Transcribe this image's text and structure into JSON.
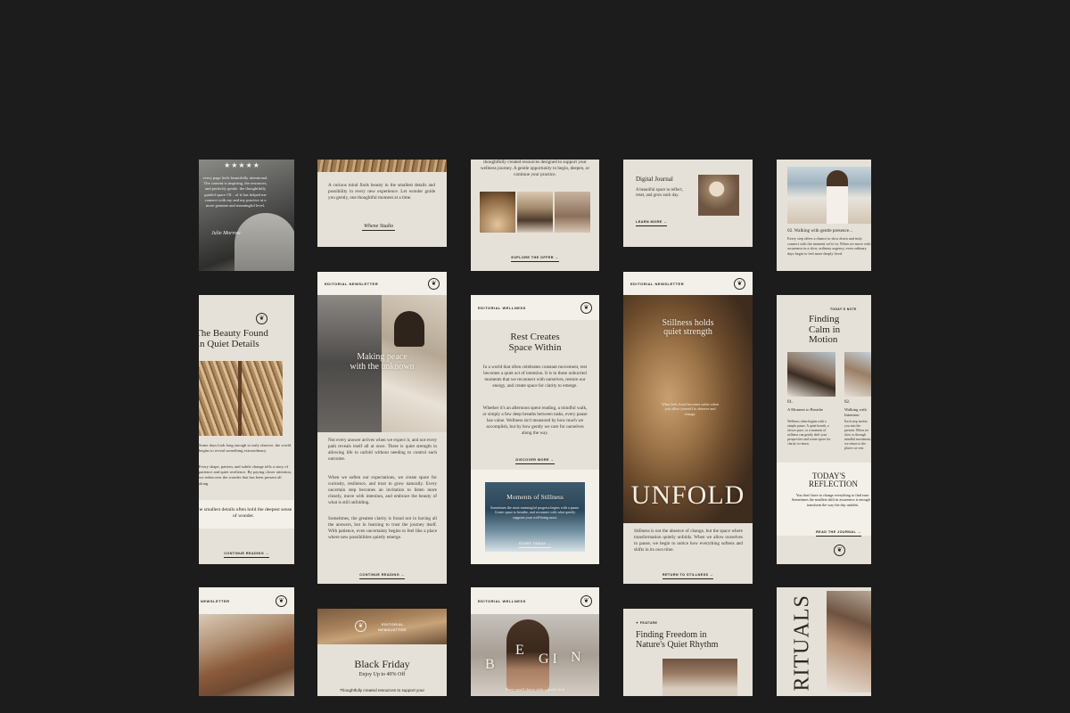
{
  "row1": {
    "c1": {
      "stars": "★★★★★",
      "text": "every page feels beautifully intentional. The content is inspiring, the resources, and perfectly gentle. the thoughtfully guided space I'll... of it has helped me connect with my and my practice at a more genuine and meaningful level.",
      "signature": "Julie Morrow"
    },
    "c2": {
      "text": "A curious mind finds beauty in the smallest details and possibility in every new experience. Let wonder guide you gently, one thoughtful moment at a time.",
      "signature": "Whene Studio"
    },
    "c3": {
      "text": "thoughtfully created resources designed to support your wellness journey. A gentle opportunity to begin, deepen, or continue your practice.",
      "cta": "EXPLORE THE OFFER →"
    },
    "c4": {
      "title": "Digital Journal",
      "text": "A beautiful space to reflect, reset, and grow each day.",
      "cta": "LEARN MORE →"
    },
    "c5": {
      "caption": "02. Walking with gentle presence...",
      "text": "Every step offers a chance to slow down and truly connect with the moment we're in. When we move with awareness in a slow, ordinary urgency, even ordinary days begin to feel more deeply lived."
    }
  },
  "row2": {
    "c1": {
      "logo": "❦",
      "title1": "The Beauty Found",
      "title2": "in Quiet Details",
      "text1": "Some days look long enough to truly observe, the world begins to reveal something extraordinary.",
      "text2": "Every shape, pattern, and subtle change tells a story of patience and quiet resilience. By paying closer attention, we rediscover the wonder that has been present all along.",
      "quote": "The smallest details often hold the deepest sense of wonder.",
      "cta": "CONTINUE READING →"
    },
    "c2": {
      "label": "EDITORIAL NEWSLETTER",
      "logo": "❦",
      "overlay1": "Making peace",
      "overlay2": "with the unknown",
      "p1": "Not every answer arrives when we expect it, and not every path reveals itself all at once. There is quiet strength in allowing life to unfold without needing to control each outcome.",
      "p2": "When we soften our expectations, we create space for curiosity, resilience, and trust to grow naturally. Every uncertain step becomes an invitation to listen more closely, move with intention, and embrace the beauty of what is still unfolding.",
      "p3": "Sometimes, the greatest clarity is found not in having all the answers, but in learning to trust the journey itself. With patience, even uncertainty begins to feel like a place where new possibilities quietly emerge.",
      "cta": "CONTINUE READING →"
    },
    "c3": {
      "label": "EDITORIAL WELLNESS",
      "logo": "❦",
      "title1": "Rest Creates",
      "title2": "Space Within",
      "p1": "In a world that often celebrates constant movement, rest becomes a quiet act of intention. It is in these unhurried moments that we reconnect with ourselves, restore our energy, and create space for clarity to emerge.",
      "p2": "Whether it's an afternoon spent reading, a mindful walk, or simply a few deep breaths between tasks, every pause has value. Wellness isn't measured by how much we accomplish, but by how gently we care for ourselves along the way.",
      "cta": "DISCOVER MORE →",
      "banner_title": "Moments of Stillness",
      "banner_text": "Sometimes the most meaningful progress begins with a pause. Create space to breathe, and reconnect with what quietly supports your well-being most.",
      "banner_cta": "START TODAY →"
    },
    "c4": {
      "label": "EDITORIAL NEWSLETTER",
      "logo": "❦",
      "overlay1": "Stillness holds",
      "overlay2": "quiet strength",
      "mid": "What feels fixed becomes softer when you allow yourself to observe and change.",
      "big": "UNFOLD",
      "text": "Stillness is not the absence of change, but the space where transformation quietly unfolds. When we allow ourselves to pause, we begin to notice how everything softens and shifts in its own time.",
      "cta": "RETURN TO STILLNESS →"
    },
    "c5": {
      "tag": "TODAY'S NOTE",
      "title1": "Finding",
      "title2": "Calm in Motion",
      "i1_num": "01.",
      "i1_title": "A Moment to Breathe",
      "i1_text": "Wellness often begins with a simple pause. A quiet breath, a slower pace, or a moment of stillness can gently shift your perspective and create space for clarity to return.",
      "i2_num": "02.",
      "i2_title": "Walking with Intention",
      "i2_text": "Each step invites you into the present. When we slow or through mindful movement, we return to the places we rest.",
      "r1": "TODAY'S",
      "r2": "REFLECTION",
      "r_text": "You don't have to change everything to find ease. Sometimes the smallest shift in awareness is enough to transform the way the day unfolds.",
      "cta": "READ THE JOURNAL →",
      "logo": "❦"
    }
  },
  "row3": {
    "c1": {
      "label": "NEWSLETTER",
      "logo": "❦"
    },
    "c2": {
      "logo": "❦",
      "label1": "EDITORIAL",
      "label2": "NEWSLETTER",
      "title": "Black Friday",
      "sub": "Enjoy Up to 40% Off",
      "text": "Thoughtfully created resources to support your"
    },
    "c3": {
      "label": "EDITORIAL WELLNESS",
      "logo": "❦",
      "w1": "B",
      "w2": "E",
      "w3": "GI",
      "w4": "N",
      "foot": "Every small choice adds a gentle shift"
    },
    "c4": {
      "tag": "✦ FEATURE",
      "title1": "Finding Freedom in",
      "title2": "Nature's Quiet Rhythm"
    },
    "c5": {
      "big": "RITUALS"
    }
  },
  "colors": {
    "bg": "#1c1c1c",
    "paper": "#e6e1d8",
    "ink": "#2a2520"
  }
}
